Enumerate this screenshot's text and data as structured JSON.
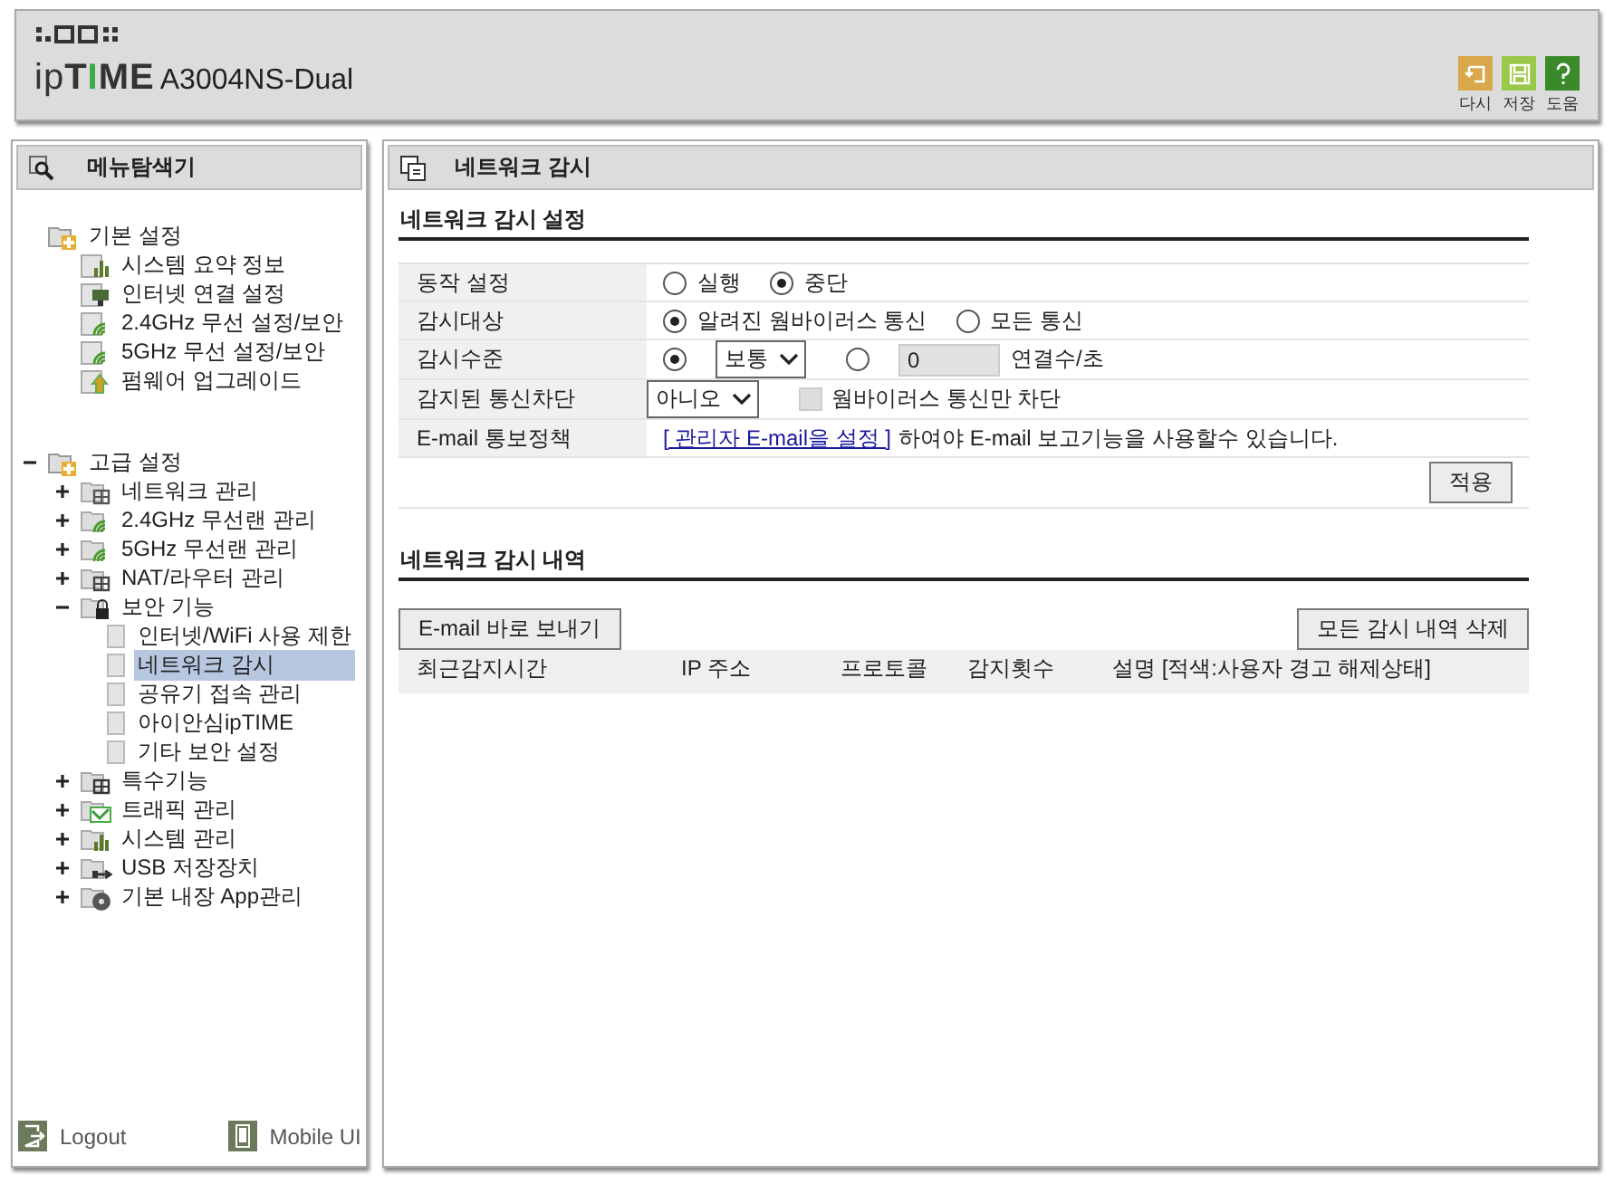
{
  "header": {
    "logo_prefix": "ip",
    "logo_brand": "TIME",
    "model": "A3004NS-Dual",
    "actions": [
      {
        "label": "다시",
        "kind": "undo"
      },
      {
        "label": "저장",
        "kind": "save"
      },
      {
        "label": "도움",
        "kind": "help"
      }
    ]
  },
  "sidebar": {
    "title": "메뉴탐색기",
    "groups": [
      {
        "label": "기본 설정",
        "children": [
          {
            "label": "시스템 요약 정보",
            "kind": "chart"
          },
          {
            "label": "인터넷 연결 설정",
            "kind": "monitor"
          },
          {
            "label": "2.4GHz 무선 설정/보안",
            "kind": "wifi"
          },
          {
            "label": "5GHz 무선 설정/보안",
            "kind": "wifi"
          },
          {
            "label": "펌웨어 업그레이드",
            "kind": "upload"
          }
        ]
      },
      {
        "label": "고급 설정",
        "expanded": true,
        "children": [
          {
            "label": "네트워크 관리",
            "kind": "network",
            "expanded": false
          },
          {
            "label": "2.4GHz 무선랜 관리",
            "kind": "wifi",
            "expanded": false
          },
          {
            "label": "5GHz 무선랜 관리",
            "kind": "wifi",
            "expanded": false
          },
          {
            "label": "NAT/라우터 관리",
            "kind": "router",
            "expanded": false
          },
          {
            "label": "보안 기능",
            "kind": "lock",
            "expanded": true,
            "children": [
              {
                "label": "인터넷/WiFi 사용 제한",
                "selected": false
              },
              {
                "label": "네트워크 감시",
                "selected": true
              },
              {
                "label": "공유기 접속 관리",
                "selected": false
              },
              {
                "label": "아이안심ipTIME",
                "selected": false
              },
              {
                "label": "기타 보안 설정",
                "selected": false
              }
            ]
          },
          {
            "label": "특수기능",
            "kind": "grid",
            "expanded": false
          },
          {
            "label": "트래픽 관리",
            "kind": "traffic",
            "expanded": false
          },
          {
            "label": "시스템 관리",
            "kind": "chart",
            "expanded": false
          },
          {
            "label": "USB 저장장치",
            "kind": "usb",
            "expanded": false
          },
          {
            "label": "기본 내장 App관리",
            "kind": "disc",
            "expanded": false
          }
        ]
      }
    ],
    "footer": [
      {
        "label": "Logout",
        "kind": "logout"
      },
      {
        "label": "Mobile UI",
        "kind": "mobile"
      }
    ]
  },
  "main": {
    "title": "네트워크 감시",
    "settings": {
      "title": "네트워크 감시 설정",
      "rows": [
        {
          "label": "동작 설정",
          "controls": [
            {
              "kind": "radio",
              "label": "실행",
              "selected": false
            },
            {
              "kind": "radio",
              "label": "중단",
              "selected": true
            }
          ]
        },
        {
          "label": "감시대상",
          "controls": [
            {
              "kind": "radio",
              "label": "알려진 웜바이러스 통신",
              "selected": true
            },
            {
              "kind": "radio",
              "label": "모든 통신",
              "selected": false
            }
          ]
        },
        {
          "label": "감시수준",
          "controls": [
            {
              "kind": "radio",
              "selected": true
            },
            {
              "kind": "select",
              "value": "보통"
            },
            {
              "kind": "radio",
              "selected": false
            },
            {
              "kind": "input",
              "value": "0",
              "disabled": true
            },
            {
              "kind": "text",
              "text": "연결수/초"
            }
          ]
        },
        {
          "label": "감지된 통신차단",
          "controls": [
            {
              "kind": "select",
              "value": "아니오"
            },
            {
              "kind": "checkbox",
              "label": "웜바이러스 통신만 차단",
              "checked": false,
              "disabled": true
            }
          ]
        },
        {
          "label": "E-mail 통보정책",
          "controls": [
            {
              "kind": "link",
              "text": "[ 관리자 E-mail을 설정 ]"
            },
            {
              "kind": "text",
              "text": "하여야 E-mail 보고기능을 사용할수 있습니다."
            }
          ]
        }
      ],
      "apply": "적용"
    },
    "log": {
      "title": "네트워크 감시 내역",
      "email_button": "E-mail 바로 보내기",
      "clear_button": "모든 감시 내역 삭제",
      "columns": [
        "최근감지시간",
        "IP 주소",
        "프로토콜",
        "감지횟수",
        "설명 [적색:사용자 경고 해제상태]"
      ]
    }
  }
}
